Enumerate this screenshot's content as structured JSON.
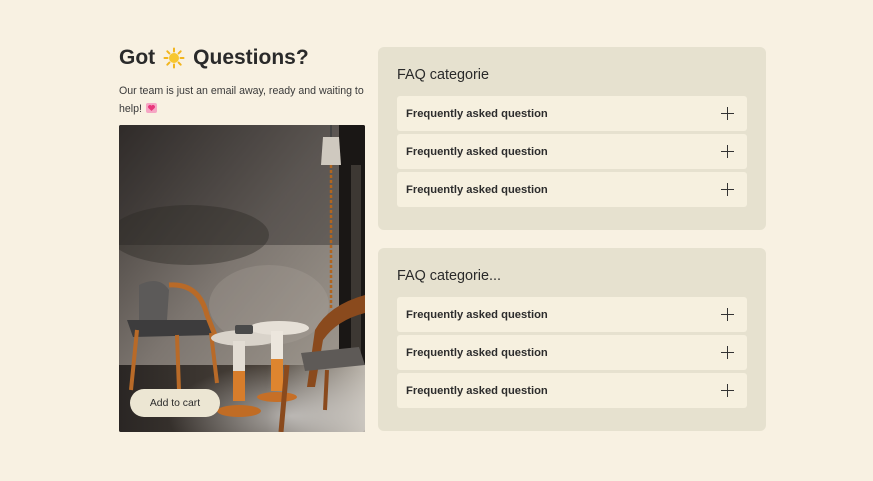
{
  "hero": {
    "title_before": "Got",
    "title_after": "Questions?",
    "subtitle": "Our team is just an email away, ready and waiting to help!",
    "title_icon": "sun-icon",
    "subtitle_icon": "heart-icon"
  },
  "image": {
    "subject": "chair-room-photo",
    "button_label": "Add to cart"
  },
  "faq_panels": [
    {
      "title": "FAQ categorie",
      "items": [
        {
          "label": "Frequently asked question"
        },
        {
          "label": "Frequently asked question"
        },
        {
          "label": "Frequently asked question"
        }
      ]
    },
    {
      "title": "FAQ categorie...",
      "items": [
        {
          "label": "Frequently asked question"
        },
        {
          "label": "Frequently asked question"
        },
        {
          "label": "Frequently asked question"
        }
      ]
    }
  ],
  "colors": {
    "background": "#f8f1e2",
    "panel": "#e6e1cf",
    "item": "#f6f0df",
    "button": "#ece6d3"
  }
}
